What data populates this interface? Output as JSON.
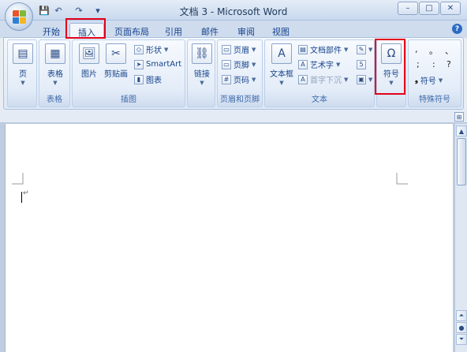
{
  "window": {
    "title": "文档 3 - Microsoft Word",
    "minimize": "–",
    "maximize": "□",
    "close": "✕",
    "help": "?"
  },
  "quick_access": {
    "save": "💾",
    "undo": "↶",
    "redo": "↷",
    "customize": "▾"
  },
  "tabs": [
    "开始",
    "插入",
    "页面布局",
    "引用",
    "邮件",
    "审阅",
    "视图"
  ],
  "active_tab": "插入",
  "ribbon": {
    "pages_group": {
      "label": "",
      "button": "页"
    },
    "table_group": {
      "label": "表格",
      "button": "表格"
    },
    "illustrations_group": {
      "label": "插图",
      "picture": "图片",
      "clipart": "剪贴画",
      "shapes": "形状",
      "smartart": "SmartArt",
      "chart": "图表"
    },
    "links_group": {
      "label": "",
      "button": "链接"
    },
    "header_footer_group": {
      "label": "页眉和页脚",
      "header": "页眉",
      "footer": "页脚",
      "page_number": "页码"
    },
    "text_group": {
      "label": "文本",
      "textbox": "文本框",
      "quickparts": "文档部件",
      "wordart": "艺术字",
      "dropcap": "首字下沉"
    },
    "symbols_group": {
      "label": "",
      "button": "符号",
      "symbol_glyph": "Ω"
    },
    "special_symbols_group": {
      "label": "特殊符号",
      "row1": [
        ",",
        "。",
        "、"
      ],
      "row2": [
        ";",
        ":",
        "?"
      ],
      "symbol_button": "符号",
      "symbol_glyph": "❟"
    }
  },
  "document": {
    "para_mark": "↵"
  },
  "colors": {
    "highlight": "#e3001b",
    "ribbon_text": "#15428b"
  }
}
